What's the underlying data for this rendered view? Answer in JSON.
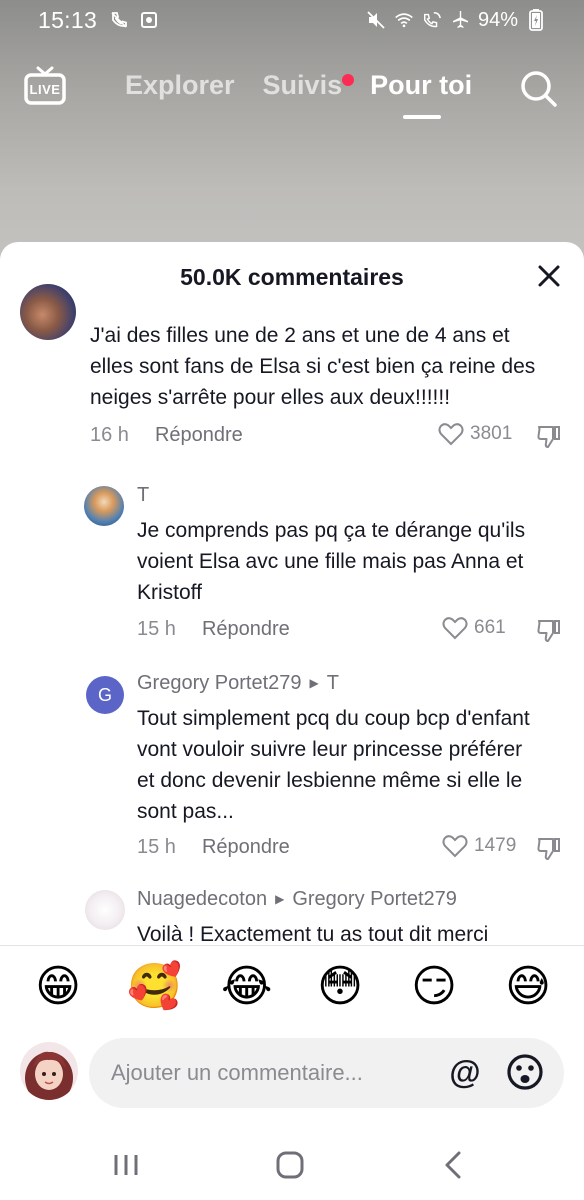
{
  "status_bar": {
    "time": "15:13",
    "battery": "94%"
  },
  "top_nav": {
    "live_label": "LIVE",
    "tabs": [
      {
        "label": "Explorer",
        "active": false
      },
      {
        "label": "Suivis",
        "active": false,
        "has_dot": true
      },
      {
        "label": "Pour toi",
        "active": true
      }
    ]
  },
  "sheet": {
    "title": "50.0K commentaires",
    "comments": [
      {
        "user": "",
        "text_lines": [
          "J'ai des filles une de 2 ans et une de 4 ans et",
          "elles sont fans de Elsa si c'est bien ça reine des",
          "neiges s'arrête pour elles aux deux!!!!!!"
        ],
        "time": "16 h",
        "reply_label": "Répondre",
        "likes": "3801"
      },
      {
        "user": "T",
        "text_lines": [
          "Je comprends pas pq ça te dérange qu'ils",
          "voient Elsa avc une fille mais pas Anna et",
          "Kristoff"
        ],
        "time": "15 h",
        "reply_label": "Répondre",
        "likes": "661"
      },
      {
        "user": "Gregory Portet279",
        "reply_to": "T",
        "avatar_letter": "G",
        "text_lines": [
          "Tout simplement pcq du coup bcp d'enfant",
          "vont vouloir suivre leur princesse préférer",
          "et donc devenir lesbienne même si elle le",
          "sont pas..."
        ],
        "time": "15 h",
        "reply_label": "Répondre",
        "likes": "1479"
      },
      {
        "user": "Nuagedecoton",
        "reply_to": "Gregory Portet279",
        "text_lines": [
          "Voilà ! Exactement tu as tout dit merci"
        ]
      }
    ]
  },
  "emoji_bar": [
    "😁",
    "🥰",
    "😂",
    "😳",
    "😏",
    "😅"
  ],
  "input": {
    "placeholder": "Ajouter un commentaire...",
    "at_symbol": "@"
  },
  "colors": {
    "accent": "#fe2c55",
    "text_primary": "#161823",
    "text_secondary": "#8a8b91"
  }
}
